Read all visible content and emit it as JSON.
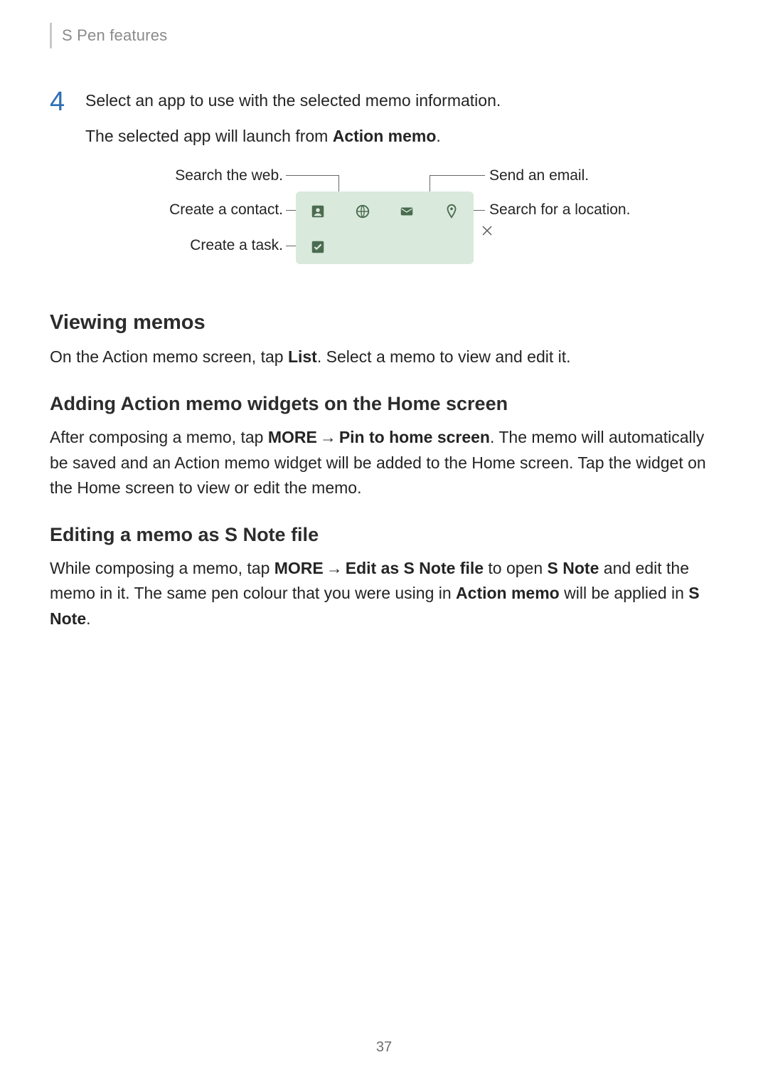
{
  "header": {
    "title": "S Pen features"
  },
  "step4": {
    "num": "4",
    "line1": "Select an app to use with the selected memo information.",
    "line2_pre": "The selected app will launch from ",
    "line2_bold": "Action memo",
    "line2_post": "."
  },
  "diagram": {
    "callouts": {
      "search_web": "Search the web.",
      "create_contact": "Create a contact.",
      "create_task": "Create a task.",
      "send_email": "Send an email.",
      "search_location": "Search for a location."
    },
    "icons": {
      "contact": "contact-icon",
      "browser": "globe-icon",
      "email": "email-icon",
      "location": "pin-icon",
      "task": "checkbox-icon",
      "close": "close-icon"
    }
  },
  "sections": {
    "viewing": {
      "heading": "Viewing memos",
      "para_pre": "On the Action memo screen, tap ",
      "bold_list": "List",
      "para_post": ". Select a memo to view and edit it."
    },
    "adding": {
      "heading": "Adding Action memo widgets on the Home screen",
      "p_pre": "After composing a memo, tap ",
      "b_more": "MORE",
      "arrow": "→",
      "b_pin": "Pin to home screen",
      "p_mid": ". The memo will automatically be saved and an Action memo widget will be added to the Home screen. Tap the widget on the Home screen to view or edit the memo."
    },
    "editing": {
      "heading": "Editing a memo as S Note file",
      "p_pre": "While composing a memo, tap ",
      "b_more": "MORE",
      "arrow": "→",
      "b_edit": "Edit as S Note file",
      "p_mid1": " to open ",
      "b_snote1": "S Note",
      "p_mid2": " and edit the memo in it. The same pen colour that you were using in ",
      "b_action": "Action memo",
      "p_mid3": " will be applied in ",
      "b_snote2": "S Note",
      "p_end": "."
    }
  },
  "page_number": "37"
}
